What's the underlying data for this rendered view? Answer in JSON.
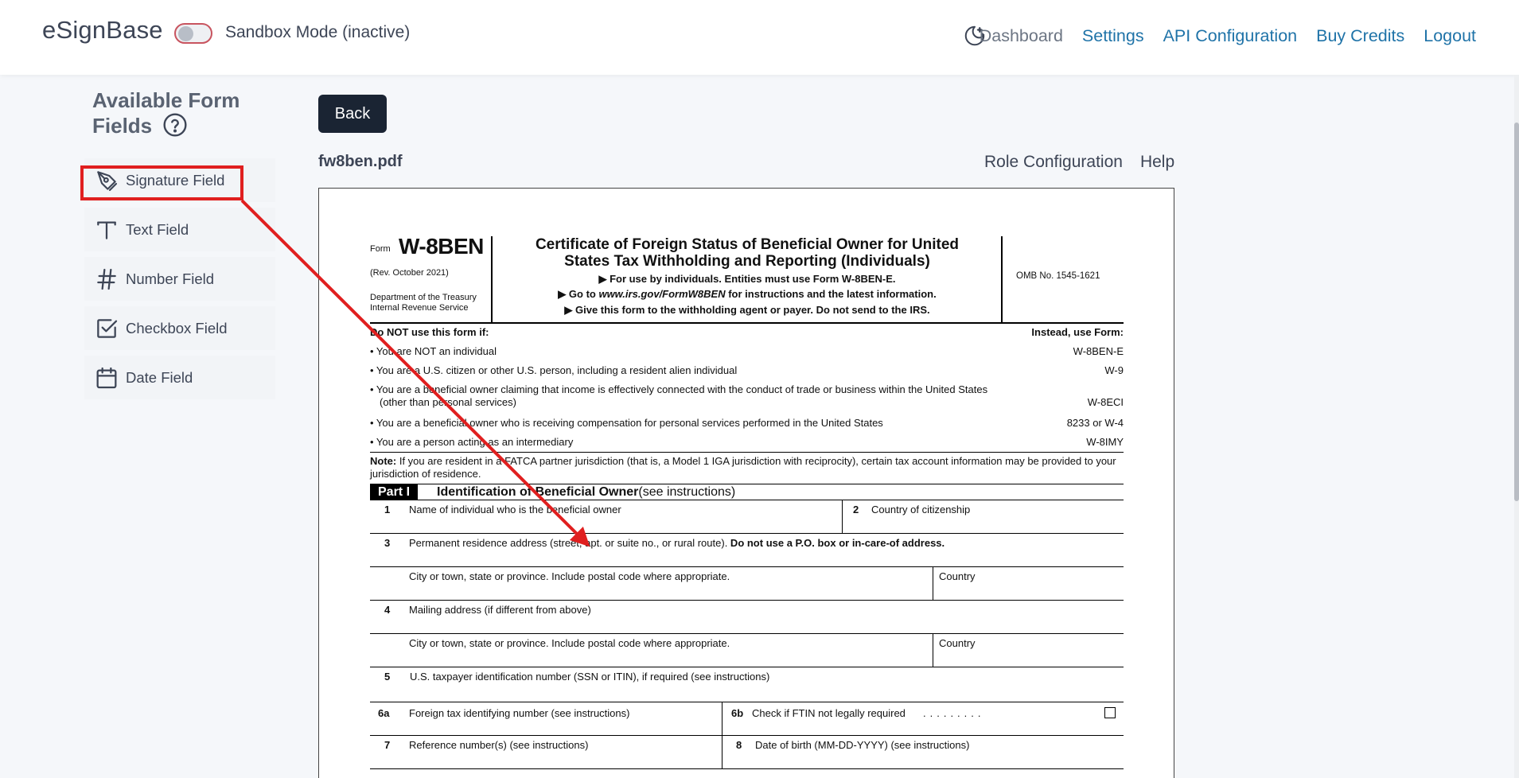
{
  "header": {
    "brand": "eSignBase",
    "sandbox_label": "Sandbox Mode (inactive)",
    "nav": {
      "dashboard": "Dashboard",
      "settings": "Settings",
      "api": "API Configuration",
      "credits": "Buy Credits",
      "logout": "Logout"
    }
  },
  "sidebar": {
    "title_line1": "Available Form",
    "title_line2": "Fields",
    "items": [
      {
        "label": "Signature Field",
        "icon": "pen-nib-icon"
      },
      {
        "label": "Text Field",
        "icon": "text-t-icon"
      },
      {
        "label": "Number Field",
        "icon": "hash-icon"
      },
      {
        "label": "Checkbox Field",
        "icon": "checkbox-icon"
      },
      {
        "label": "Date Field",
        "icon": "calendar-icon"
      }
    ]
  },
  "main": {
    "back_label": "Back",
    "filename": "fw8ben.pdf",
    "role_config": "Role Configuration",
    "help": "Help"
  },
  "pdf": {
    "form_word": "Form",
    "form_no": "W-8BEN",
    "rev": "(Rev. October  2021)",
    "dept1": "Department of the Treasury",
    "dept2": "Internal Revenue Service",
    "title1": "Certificate of Foreign Status of Beneficial Owner for United",
    "title2": "States Tax Withholding and Reporting (Individuals)",
    "sub1": "▶ For use by individuals. Entities must use Form W-8BEN-E.",
    "sub2_pre": "▶ Go to ",
    "sub2_url": "www.irs.gov/FormW8BEN",
    "sub2_post": " for instructions and the latest information.",
    "sub3": "▶ Give this form to the withholding agent or payer. Do not send to the IRS.",
    "omb": "OMB No. 1545-1621",
    "donot": "Do NOT use this form if:",
    "instead": "Instead, use Form:",
    "bullets": [
      {
        "text": "• You are NOT an individual",
        "form": "W-8BEN-E"
      },
      {
        "text": "• You are a U.S. citizen or other U.S. person, including a resident alien individual",
        "form": "W-9"
      },
      {
        "text": "• You are a beneficial owner claiming that income is effectively connected with the conduct of trade or business within the United States",
        "text2": "(other than personal services)",
        "form": "W-8ECI"
      },
      {
        "text": "• You are a beneficial owner who is receiving compensation for personal services performed in the United States",
        "form": "8233 or W-4"
      },
      {
        "text": "• You are a person acting as an intermediary",
        "form": "W-8IMY"
      }
    ],
    "note_label": "Note:",
    "note": " If you are resident in a FATCA partner jurisdiction (that is, a Model 1 IGA jurisdiction with reciprocity), certain tax account information may be provided to your jurisdiction of residence.",
    "part1_tag": "Part I",
    "part1_title": "Identification of Beneficial Owner",
    "part1_suffix": " (see instructions)",
    "lines": {
      "l1": "Name of individual who is the beneficial owner",
      "l2": "Country of citizenship",
      "l3": "Permanent residence address (street, apt. or suite no., or rural route).",
      "l3_bold": " Do not use a P.O. box or in-care-of address.",
      "city": "City or town, state or province. Include postal code where appropriate.",
      "country": "Country",
      "l4": "Mailing address (if different from above)",
      "l5": "U.S. taxpayer identification number (SSN or ITIN), if required (see instructions)",
      "l6a": "Foreign tax identifying number (see instructions)",
      "l6b": "Check if FTIN not legally required",
      "l7": "Reference number(s) (see instructions)",
      "l8": "Date of birth (MM-DD-YYYY) (see instructions)"
    }
  },
  "colors": {
    "accent": "#1f73a8",
    "highlight": "#e01f1f",
    "button": "#1a2433"
  }
}
